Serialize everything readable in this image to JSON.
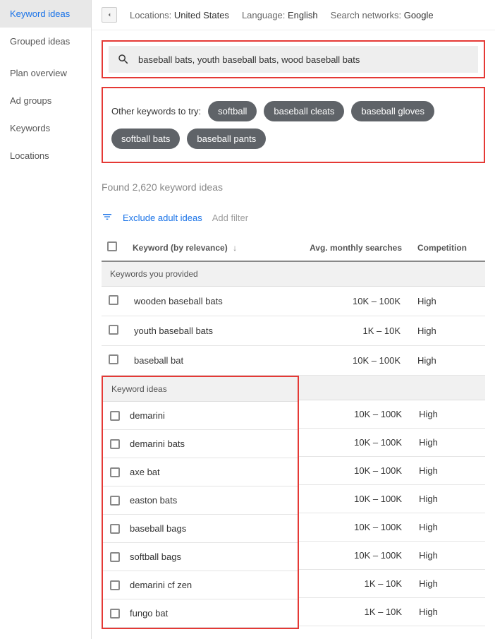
{
  "sidebar": {
    "items": [
      {
        "label": "Keyword ideas",
        "active": true
      },
      {
        "label": "Grouped ideas",
        "active": false
      },
      {
        "label": "Plan overview",
        "active": false
      },
      {
        "label": "Ad groups",
        "active": false
      },
      {
        "label": "Keywords",
        "active": false
      },
      {
        "label": "Locations",
        "active": false
      }
    ]
  },
  "topbar": {
    "locations_label": "Locations:",
    "locations_value": "United States",
    "language_label": "Language:",
    "language_value": "English",
    "network_label": "Search networks:",
    "network_value": "Google"
  },
  "search": {
    "value": "baseball bats, youth baseball bats, wood baseball bats"
  },
  "suggest": {
    "prefix": "Other keywords to try:",
    "chips": [
      "softball",
      "baseball cleats",
      "baseball gloves",
      "softball bats",
      "baseball pants"
    ]
  },
  "found_text": "Found 2,620 keyword ideas",
  "filters": {
    "exclude": "Exclude adult ideas",
    "add": "Add filter"
  },
  "columns": {
    "keyword": "Keyword (by relevance)",
    "searches": "Avg. monthly searches",
    "competition": "Competition"
  },
  "sections": {
    "provided": "Keywords you provided",
    "ideas": "Keyword ideas"
  },
  "rows_provided": [
    {
      "kw": "wooden baseball bats",
      "searches": "10K – 100K",
      "comp": "High"
    },
    {
      "kw": "youth baseball bats",
      "searches": "1K – 10K",
      "comp": "High"
    },
    {
      "kw": "baseball bat",
      "searches": "10K – 100K",
      "comp": "High"
    }
  ],
  "rows_ideas": [
    {
      "kw": "demarini",
      "searches": "10K – 100K",
      "comp": "High"
    },
    {
      "kw": "demarini bats",
      "searches": "10K – 100K",
      "comp": "High"
    },
    {
      "kw": "axe bat",
      "searches": "10K – 100K",
      "comp": "High"
    },
    {
      "kw": "easton bats",
      "searches": "10K – 100K",
      "comp": "High"
    },
    {
      "kw": "baseball bags",
      "searches": "10K – 100K",
      "comp": "High"
    },
    {
      "kw": "softball bags",
      "searches": "10K – 100K",
      "comp": "High"
    },
    {
      "kw": "demarini cf zen",
      "searches": "1K – 10K",
      "comp": "High"
    },
    {
      "kw": "fungo bat",
      "searches": "1K – 10K",
      "comp": "High"
    }
  ]
}
